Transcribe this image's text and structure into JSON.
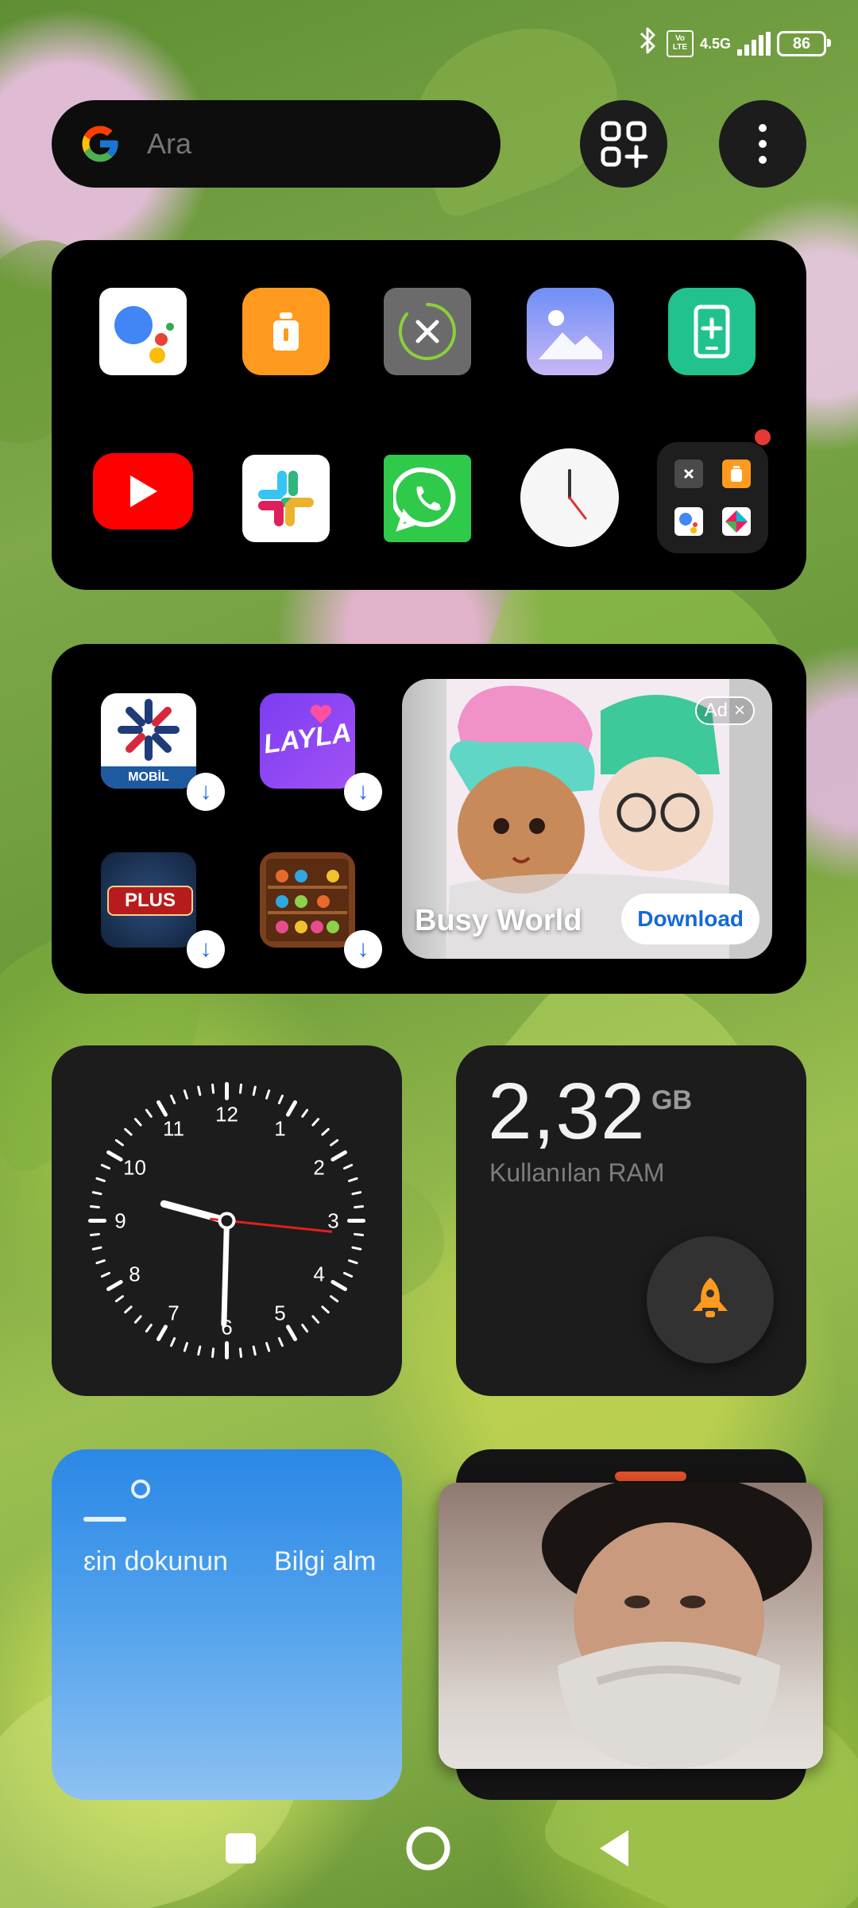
{
  "status_bar": {
    "network_type": "4.5G",
    "volte": "Vo LTE",
    "battery": "86"
  },
  "search": {
    "placeholder": "Ara"
  },
  "app_dock": {
    "apps": [
      "Google Assistant",
      "Cleaner",
      "Close",
      "Gallery",
      "Phone Manager",
      "YouTube",
      "Slack",
      "WhatsApp",
      "Clock"
    ],
    "folder_has_badge": true
  },
  "suggestions": {
    "apps": [
      "MOBİL",
      "LAYLA",
      "PLUS",
      "Sort puzzle"
    ],
    "mobil_label": "MOBİL",
    "layla_label": "LAYLA",
    "plus_label": "PLUS",
    "ad": {
      "badge": "Ad",
      "title": "Busy World",
      "button": "Download"
    }
  },
  "clock_widget": {
    "numbers": [
      "12",
      "1",
      "2",
      "3",
      "4",
      "5",
      "6",
      "7",
      "8",
      "9",
      "10",
      "11"
    ],
    "time": {
      "hour": 9,
      "minute": 30,
      "second": 16
    }
  },
  "ram_widget": {
    "value": "2,32",
    "unit": "GB",
    "label": "Kullanılan RAM"
  },
  "weather_widget": {
    "text_left": "ɛin dokunun",
    "text_right": "Bilgi alm"
  },
  "colors": {
    "accent_orange": "#FF9A1F",
    "second_hand": "#E0201B",
    "ad_button_text": "#1569D6",
    "weather_top": "#2B88E6"
  }
}
